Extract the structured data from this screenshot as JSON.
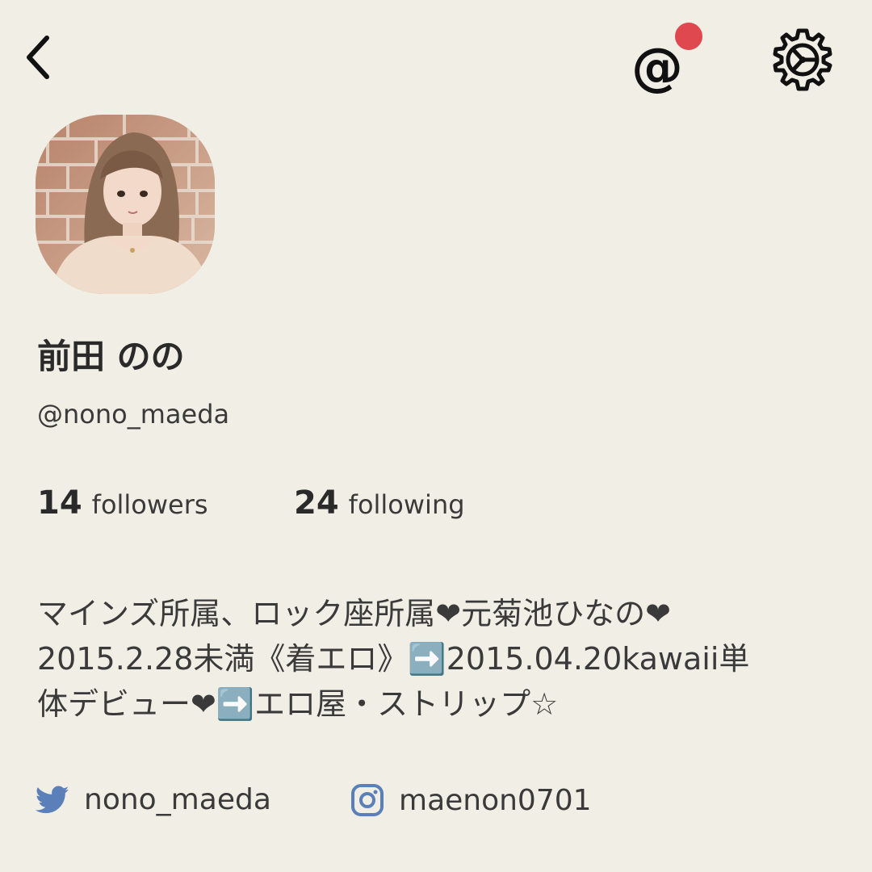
{
  "topbar": {
    "back_icon": "chevron-left-icon",
    "mention_icon": "at-icon",
    "mention_symbol": "@",
    "notification_color": "#e0484f",
    "settings_icon": "gear-icon"
  },
  "profile": {
    "display_name": "前田 のの",
    "username": "@nono_maeda",
    "followers_count": "14",
    "followers_label": "followers",
    "following_count": "24",
    "following_label": "following",
    "bio": "マインズ所属、ロック座所属❤元菊池ひなの❤\n2015.2.28未満《着エロ》➡️2015.04.20kawaii単\n体デビュー❤➡️エロ屋・ストリップ☆"
  },
  "social": {
    "twitter_icon": "twitter-bird-icon",
    "twitter_handle": "nono_maeda",
    "instagram_icon": "instagram-icon",
    "instagram_handle": "maenon0701",
    "icon_color": "#5b7fb8"
  },
  "colors": {
    "background": "#f1efe5",
    "text": "#2b2b2b"
  }
}
